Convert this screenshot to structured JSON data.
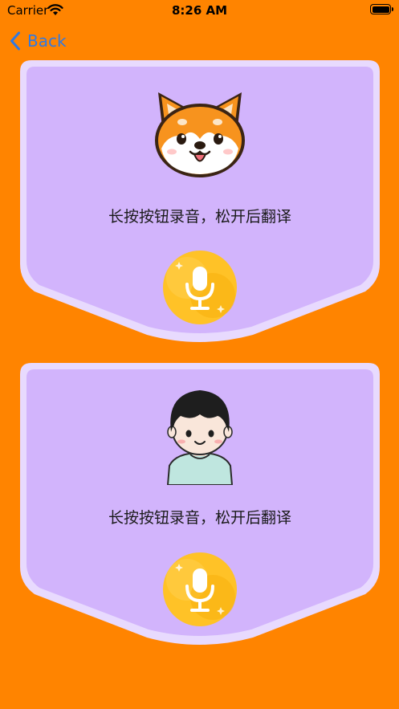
{
  "status_bar": {
    "carrier": "Carrier",
    "time": "8:26 AM",
    "wifi_icon": "wifi-icon",
    "battery_icon": "battery-icon"
  },
  "nav": {
    "back_label": "Back",
    "back_icon": "chevron-left-icon"
  },
  "colors": {
    "background": "#FF8400",
    "card_fill": "#D2B4FC",
    "card_border": "#E8DAFE",
    "accent": "#2F79E4",
    "mic_button": "#FFC227"
  },
  "panels": [
    {
      "avatar_icon": "shiba-dog-icon",
      "prompt": "长按按钮录音，松开后翻译",
      "mic_icon": "microphone-icon"
    },
    {
      "avatar_icon": "boy-avatar-icon",
      "prompt": "长按按钮录音，松开后翻译",
      "mic_icon": "microphone-icon"
    }
  ]
}
